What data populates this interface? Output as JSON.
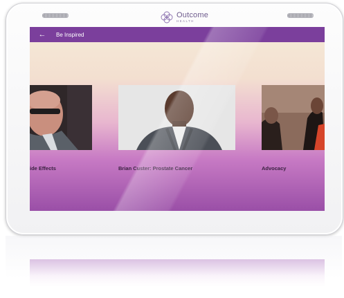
{
  "device": {
    "brand_name": "Outcome",
    "brand_sub": "HEALTH"
  },
  "appbar": {
    "back_icon": "←",
    "title": "Be Inspired"
  },
  "videos": [
    {
      "caption": "ide Effects"
    },
    {
      "caption": "Brian Custer: Prostate Cancer"
    },
    {
      "caption": "Advocacy"
    }
  ],
  "colors": {
    "appbar": "#7b3f9c",
    "caption": "#3a2140"
  }
}
